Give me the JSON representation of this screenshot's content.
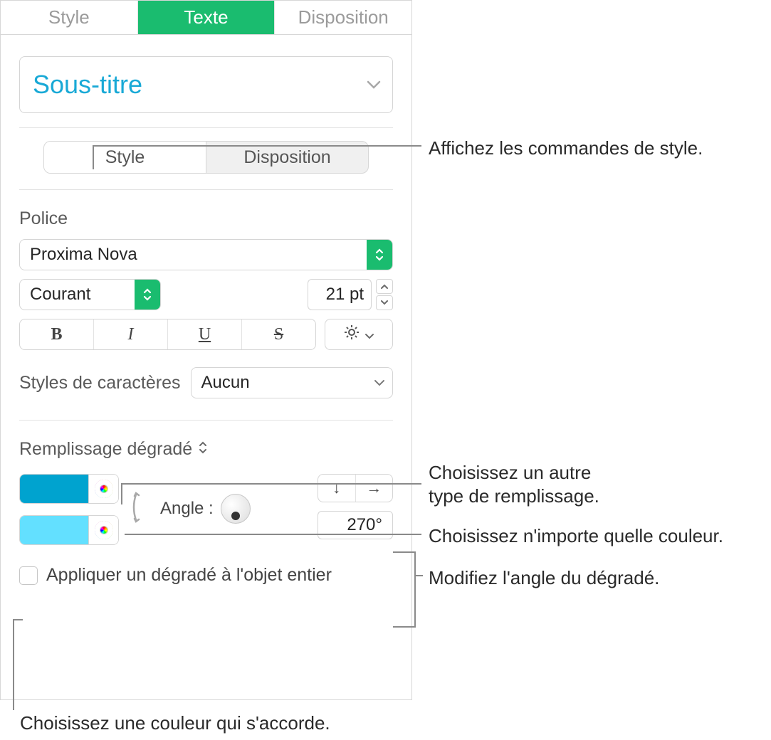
{
  "tabs": {
    "style": "Style",
    "texte": "Texte",
    "disposition": "Disposition"
  },
  "paragraph_style": "Sous-titre",
  "segmented": {
    "style": "Style",
    "disposition": "Disposition"
  },
  "font": {
    "section_label": "Police",
    "family": "Proxima Nova",
    "weight": "Courant",
    "size": "21 pt",
    "bold": "B",
    "italic": "I",
    "underline": "U",
    "strike": "S"
  },
  "char_styles": {
    "label": "Styles de caractères",
    "value": "Aucun"
  },
  "fill": {
    "label": "Remplissage dégradé",
    "color1": "#00A3CF",
    "color2": "#63E0FF",
    "angle_label": "Angle :",
    "angle_value": "270°"
  },
  "apply_whole": "Appliquer un dégradé à l'objet entier",
  "callouts": {
    "style_cmds": "Affichez les commandes de style.",
    "fill_type": "Choisissez un autre\ntype de remplissage.",
    "any_color": "Choisissez n'importe quelle couleur.",
    "angle": "Modifiez l'angle du dégradé.",
    "match_color": "Choisissez une couleur qui s'accorde."
  }
}
